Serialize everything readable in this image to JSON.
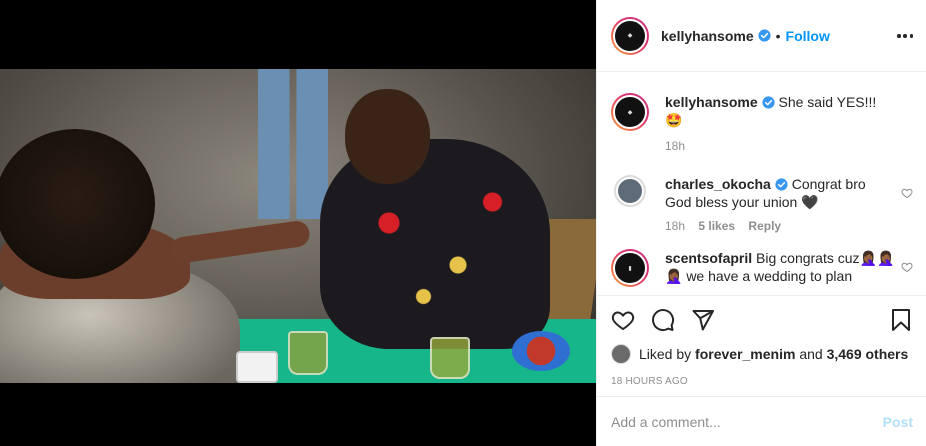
{
  "post": {
    "username": "kellyhansome",
    "follow_label": "Follow",
    "separator": "•",
    "caption": {
      "username": "kellyhansome",
      "text": "She said YES!!! 🤩",
      "age": "18h"
    },
    "comments": [
      {
        "username": "charles_okocha",
        "verified": true,
        "text": "Congrat bro God bless your union 🖤",
        "age": "18h",
        "likes": "5 likes",
        "reply_label": "Reply"
      },
      {
        "username": "scentsofapril",
        "verified": false,
        "text": "Big congrats cuz🤦🏾‍♀️🤦🏾‍♀️🤦🏾‍♀️ we have a wedding to plan"
      }
    ],
    "liked_by": {
      "prefix": "Liked by",
      "user": "forever_menim",
      "and": "and",
      "others": "3,469 others"
    },
    "timestamp": "18 HOURS AGO",
    "add_comment_placeholder": "Add a comment...",
    "post_label": "Post"
  },
  "icons": {
    "header_more": "more-dots-icon",
    "verified": "verified-badge-icon",
    "like": "heart-icon",
    "comment": "comment-icon",
    "share": "share-icon",
    "save": "bookmark-icon"
  },
  "colors": {
    "link_blue": "#0095f6",
    "post_disabled": "#b2dffc",
    "muted": "#8e8e8e",
    "text": "#262626"
  }
}
